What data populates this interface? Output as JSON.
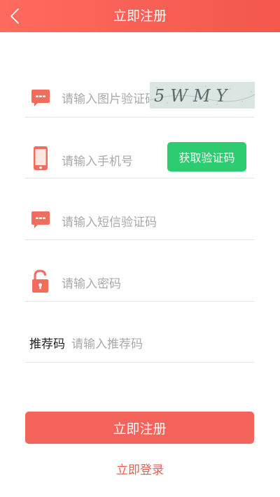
{
  "header": {
    "title": "立即注册",
    "back_icon": "chevron-left-icon"
  },
  "form": {
    "captcha": {
      "icon": "message-dots-icon",
      "placeholder": "请输入图片验证码",
      "image_text": "5WMY"
    },
    "phone": {
      "icon": "phone-icon",
      "placeholder": "请输入手机号",
      "get_code_label": "获取验证码"
    },
    "sms": {
      "icon": "message-dots-icon",
      "placeholder": "请输入短信验证码"
    },
    "password": {
      "icon": "lock-icon",
      "placeholder": "请输入密码"
    },
    "referral": {
      "label": "推荐码",
      "placeholder": "请输入推荐码"
    }
  },
  "actions": {
    "submit_label": "立即注册",
    "login_label": "立即登录"
  },
  "colors": {
    "accent": "#f5645a",
    "header": "#f3574e",
    "code_button": "#2ecc71",
    "icon": "#f26b5b"
  }
}
